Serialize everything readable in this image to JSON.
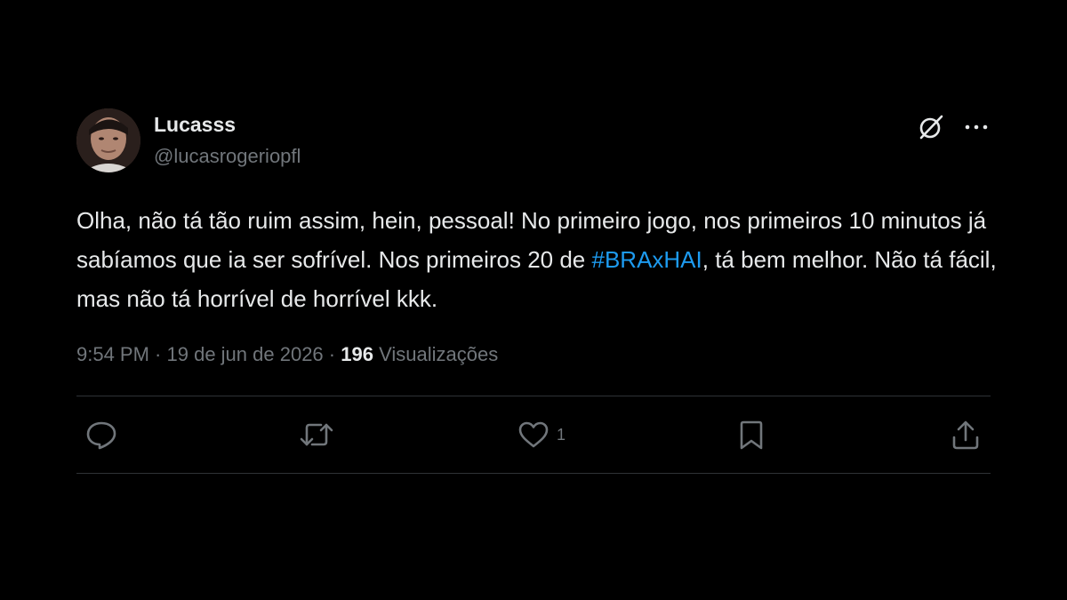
{
  "user": {
    "display_name": "Lucasss",
    "handle": "@lucasrogeriopfl",
    "avatar_icon": "user-avatar"
  },
  "header_actions": {
    "grok_icon": "grok-icon",
    "more_icon": "more-options-icon"
  },
  "tweet": {
    "text_part1": "Olha, não tá tão ruim assim, hein, pessoal! No primeiro jogo, nos primeiros 10 minutos já sabíamos que ia ser sofrível. Nos primeiros 20 de ",
    "hashtag": "#BRAxHAI",
    "text_part2": ", tá bem melhor. Não tá fácil, mas não tá horrível de horrível kkk.",
    "time": "9:54 PM",
    "separator": " · ",
    "date": "19 de jun de 2026",
    "views_count": "196",
    "views_label": "Visualizações"
  },
  "actions": {
    "reply_icon": "reply-icon",
    "retweet_icon": "retweet-icon",
    "like_icon": "heart-icon",
    "like_count": "1",
    "bookmark_icon": "bookmark-icon",
    "share_icon": "share-icon"
  },
  "colors": {
    "background": "#000000",
    "text": "#e7e9ea",
    "secondary": "#71767b",
    "accent": "#1d9bf0",
    "divider": "#2f3336"
  }
}
